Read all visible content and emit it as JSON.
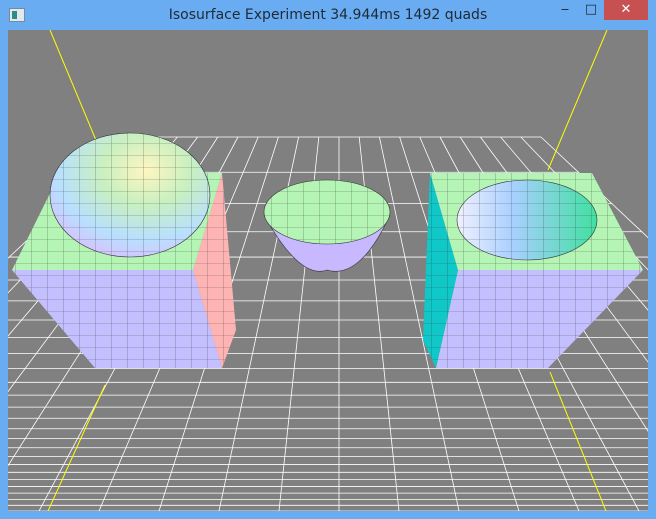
{
  "window": {
    "title": "Isosurface Experiment 34.944ms  1492 quads",
    "minimize_label": "‒",
    "maximize_label": "□",
    "close_label": "✕"
  },
  "colors": {
    "titlebar": "#6aacf2",
    "background": "#808080",
    "grid": "#ffffff",
    "axis": "#ffff00",
    "top_face": "#b4f4b4",
    "front_face": "#c4c0ff",
    "side_left": "#ffb4b4",
    "side_right": "#10c8c8"
  }
}
